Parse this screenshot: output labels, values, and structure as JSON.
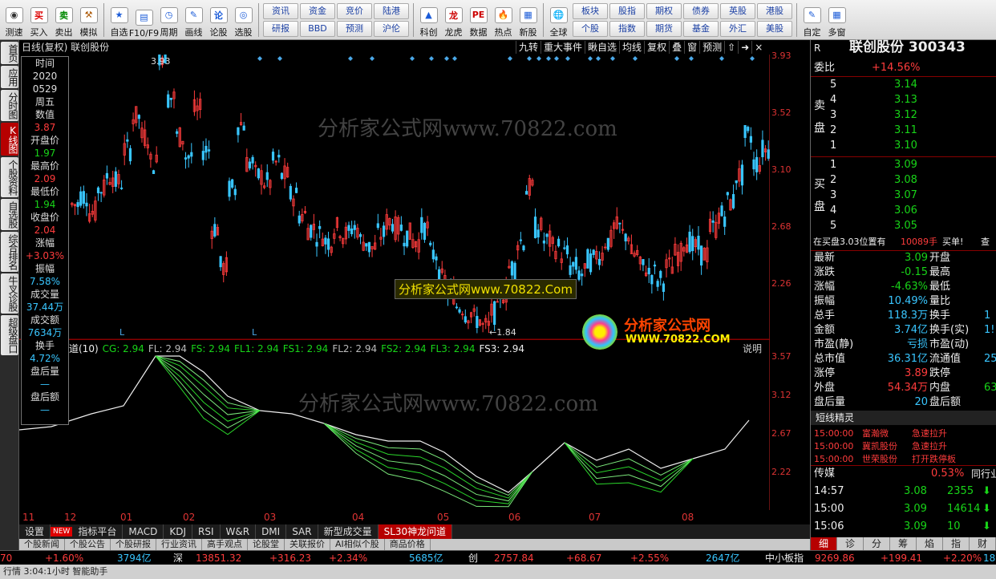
{
  "toolbar": {
    "groups1": [
      {
        "label": "测速",
        "icon": "speed-icon",
        "sym": "◉"
      },
      {
        "label": "买入",
        "icon": "buy-icon",
        "sym": "买",
        "color": "#d00"
      },
      {
        "label": "卖出",
        "icon": "sell-icon",
        "sym": "卖",
        "color": "#080"
      },
      {
        "label": "模拟",
        "icon": "hammer-icon",
        "sym": "⚒",
        "color": "#a50"
      }
    ],
    "groups2": [
      {
        "label": "自选",
        "icon": "star-icon",
        "sym": "★",
        "color": "#1a5bd8"
      },
      {
        "label": "F10/F9",
        "icon": "f10-icon",
        "sym": "▤",
        "color": "#1a5bd8"
      },
      {
        "label": "周期",
        "icon": "clock-icon",
        "sym": "◷",
        "color": "#1a5bd8"
      },
      {
        "label": "画线",
        "icon": "pencil-icon",
        "sym": "✎",
        "color": "#1a5bd8"
      },
      {
        "label": "论股",
        "icon": "discuss-icon",
        "sym": "论",
        "color": "#1a5bd8"
      },
      {
        "label": "选股",
        "icon": "select-icon",
        "sym": "◎",
        "color": "#1a5bd8"
      }
    ],
    "pairs1": [
      "资讯",
      "资金",
      "竞价",
      "陆港",
      "研报",
      "BBD",
      "预测",
      "沪伦"
    ],
    "groups3": [
      {
        "label": "科创",
        "icon": "kechuang-icon",
        "sym": "▲",
        "color": "#1a5bd8"
      },
      {
        "label": "龙虎",
        "icon": "dragon-icon",
        "sym": "龙",
        "color": "#c00"
      },
      {
        "label": "数据",
        "icon": "pe-icon",
        "sym": "PE",
        "color": "#c00"
      },
      {
        "label": "热点",
        "icon": "hot-icon",
        "sym": "🔥",
        "color": "#c00"
      },
      {
        "label": "新股",
        "icon": "ipo-icon",
        "sym": "▦",
        "color": "#1a5bd8"
      }
    ],
    "globe": {
      "label": "全球",
      "icon": "globe-icon",
      "sym": "🌐"
    },
    "pairs2": [
      "板块",
      "股指",
      "期权",
      "债券",
      "英股",
      "港股",
      "个股",
      "指数",
      "期货",
      "基金",
      "外汇",
      "美股"
    ],
    "groups4": [
      {
        "label": "自定",
        "icon": "custom-icon",
        "sym": "✎",
        "color": "#1a5bd8"
      },
      {
        "label": "多窗",
        "icon": "multiwin-icon",
        "sym": "▦",
        "color": "#1a5bd8"
      }
    ]
  },
  "leftnav": [
    "首页",
    "应用",
    "分时图",
    "K线图",
    "个股资料",
    "自选股",
    "综合排名",
    "牛叉诊股",
    "超级盘口"
  ],
  "leftnav_active": "K线图",
  "chart_header": {
    "title": "日线(复权)  联创股份",
    "tools": [
      "九转",
      "重大事件",
      "瞅自选",
      "均线",
      "复权",
      "叠",
      "窗",
      "预测",
      "⇧",
      "➜",
      "×"
    ]
  },
  "price_axis": [
    "3.93",
    "3.52",
    "3.10",
    "2.68",
    "2.26"
  ],
  "indicator_axis": [
    "3.57",
    "3.12",
    "2.67",
    "2.22"
  ],
  "x_labels": [
    "11",
    "12",
    "01",
    "02",
    "03",
    "04",
    "05",
    "06",
    "07",
    "08"
  ],
  "annotations": {
    "high": "3.93",
    "low": "1.84",
    "L1": "L",
    "L2": "L",
    "explain": "说明"
  },
  "infobox": [
    {
      "label": "时间",
      "value": "2020",
      "vcolor": "#ddd"
    },
    {
      "label": "",
      "value": "0529",
      "vcolor": "#ddd"
    },
    {
      "label": "周五",
      "value": "",
      "vcolor": "#ddd"
    },
    {
      "label": "数值",
      "value": "3.87",
      "vcolor": "#ff3c3c"
    },
    {
      "label": "开盘价",
      "value": "1.97",
      "vcolor": "#18d418"
    },
    {
      "label": "最高价",
      "value": "2.09",
      "vcolor": "#ff3c3c"
    },
    {
      "label": "最低价",
      "value": "1.94",
      "vcolor": "#18d418"
    },
    {
      "label": "收盘价",
      "value": "2.04",
      "vcolor": "#ff3c3c"
    },
    {
      "label": "涨幅",
      "value": "+3.03%",
      "vcolor": "#ff3c3c"
    },
    {
      "label": "振幅",
      "value": "7.58%",
      "vcolor": "#39c6ff"
    },
    {
      "label": "成交量",
      "value": "37.44万",
      "vcolor": "#39c6ff"
    },
    {
      "label": "成交额",
      "value": "7634万",
      "vcolor": "#39c6ff"
    },
    {
      "label": "换手",
      "value": "4.72%",
      "vcolor": "#39c6ff"
    },
    {
      "label": "盘后量",
      "value": "—",
      "vcolor": "#39c6ff"
    },
    {
      "label": "盘后额",
      "value": "—",
      "vcolor": "#39c6ff"
    }
  ],
  "indicator_legend": [
    {
      "text": "道(10)",
      "color": "#eee"
    },
    {
      "text": "CG: 2.94",
      "color": "#18d418"
    },
    {
      "text": "FL: 2.94",
      "color": "#bbb"
    },
    {
      "text": "FS: 2.94",
      "color": "#18d418"
    },
    {
      "text": "FL1: 2.94",
      "color": "#18d418"
    },
    {
      "text": "FS1: 2.94",
      "color": "#18d418"
    },
    {
      "text": "FL2: 2.94",
      "color": "#bbb"
    },
    {
      "text": "FS2: 2.94",
      "color": "#18d418"
    },
    {
      "text": "FL3: 2.94",
      "color": "#18d418"
    },
    {
      "text": "FS3: 2.94",
      "color": "#eee"
    }
  ],
  "watermarks": {
    "top": "分析家公式网www.70822.com",
    "mid": "分析家公式网www.70822.Com",
    "bottom": "分析家公式网www.70822.com",
    "logo1": "分析家公式网",
    "logo2": "WWW.70822.COM"
  },
  "bottomtabs": [
    "设置",
    "NEW",
    "指标平台",
    "MACD",
    "KDJ",
    "RSI",
    "W&R",
    "DMI",
    "SAR",
    "新型成交量",
    "SL30神龙问道"
  ],
  "bottomtabs2": [
    "个股新闻",
    "个股公告",
    "个股研报",
    "行业资讯",
    "高手观点",
    "论股堂",
    "关联报价",
    "AI相似个股",
    "商品价格"
  ],
  "statusbar": [
    {
      "t": "70",
      "c": "red"
    },
    {
      "t": "+1.60%",
      "c": "red"
    },
    {
      "t": "3794亿",
      "c": "cyan"
    },
    {
      "t": "深",
      "c": "white"
    },
    {
      "t": "13851.32",
      "c": "red"
    },
    {
      "t": "+316.23",
      "c": "red"
    },
    {
      "t": "+2.34%",
      "c": "red"
    },
    {
      "t": "5685亿",
      "c": "cyan"
    },
    {
      "t": "创",
      "c": "white"
    },
    {
      "t": "2757.84",
      "c": "red"
    },
    {
      "t": "+68.67",
      "c": "red"
    },
    {
      "t": "+2.55%",
      "c": "red"
    },
    {
      "t": "2647亿",
      "c": "cyan"
    },
    {
      "t": "中小板指",
      "c": "white"
    },
    {
      "t": "9269.86",
      "c": "red"
    },
    {
      "t": "+199.41",
      "c": "red"
    },
    {
      "t": "+2.20%",
      "c": "red"
    },
    {
      "t": "18",
      "c": "cyan"
    }
  ],
  "statusbar2": "行情  3:04:1小时  智能助手",
  "right": {
    "r_label": "R",
    "name": "联创股份 300343",
    "webi_label": "委比",
    "webi_value": "+14.56%",
    "sell_label": "卖盘",
    "sell": [
      {
        "n": "5",
        "p": "3.14"
      },
      {
        "n": "4",
        "p": "3.13"
      },
      {
        "n": "3",
        "p": "3.12"
      },
      {
        "n": "2",
        "p": "3.11"
      },
      {
        "n": "1",
        "p": "3.10"
      }
    ],
    "buy_label": "买盘",
    "buy": [
      {
        "n": "1",
        "p": "3.09"
      },
      {
        "n": "2",
        "p": "3.08"
      },
      {
        "n": "3",
        "p": "3.07"
      },
      {
        "n": "4",
        "p": "3.06"
      },
      {
        "n": "5",
        "p": "3.05"
      }
    ],
    "notice": "在买盘3.03位置有",
    "notice_vol": "10089手",
    "notice_tail": "买单!",
    "notice_end": "查",
    "stats": [
      {
        "l": "最新",
        "v": "3.09",
        "vc": "green",
        "l2": "开盘"
      },
      {
        "l": "涨跌",
        "v": "-0.15",
        "vc": "green",
        "l2": "最高"
      },
      {
        "l": "涨幅",
        "v": "-4.63%",
        "vc": "green",
        "l2": "最低"
      },
      {
        "l": "振幅",
        "v": "10.49%",
        "vc": "cyan",
        "l2": "量比"
      },
      {
        "l": "总手",
        "v": "118.3万",
        "vc": "cyan",
        "l2": "换手",
        "v2": "1",
        "v2c": "cyan"
      },
      {
        "l": "金额",
        "v": "3.74亿",
        "vc": "cyan",
        "l2": "换手(实)",
        "v2": "1!",
        "v2c": "cyan"
      },
      {
        "l": "市盈(静)",
        "v": "亏损",
        "vc": "cyan",
        "l2": "市盈(动)"
      },
      {
        "l": "总市值",
        "v": "36.31亿",
        "vc": "cyan",
        "l2": "流通值",
        "v2": "25",
        "v2c": "cyan"
      },
      {
        "l": "涨停",
        "v": "3.89",
        "vc": "red",
        "l2": "跌停"
      },
      {
        "l": "外盘",
        "v": "54.34万",
        "vc": "red",
        "l2": "内盘",
        "v2": "63",
        "v2c": "green"
      },
      {
        "l": "盘后量",
        "v": "20",
        "vc": "cyan",
        "l2": "盘后额"
      }
    ],
    "spirit_title": "短线精灵",
    "spirit": [
      {
        "t": "15:00:00",
        "s": "富瀚微",
        "e": "急速拉升"
      },
      {
        "t": "15:00:00",
        "s": "冀凯股份",
        "e": "急速拉升"
      },
      {
        "t": "15:00:00",
        "s": "世荣股份",
        "e": "打开跌停板"
      }
    ],
    "media_label": "传媒",
    "media_value": "0.53%",
    "media_tail": "同行业",
    "ticks": [
      {
        "t": "14:57",
        "p": "3.08",
        "v": "2355"
      },
      {
        "t": "15:00",
        "p": "3.09",
        "v": "14614"
      },
      {
        "t": "15:06",
        "p": "3.09",
        "v": "10"
      }
    ],
    "tabs": [
      "细",
      "诊",
      "分",
      "筹",
      "焰",
      "指",
      "财"
    ]
  },
  "colors": {
    "up": "#ff3c3c",
    "down": "#39c6ff",
    "axis": "#cc2222",
    "bg": "#000000",
    "accent": "#b60000"
  },
  "chart_data": {
    "type": "candlestick",
    "ylim": [
      1.84,
      3.93
    ],
    "x_ticks": [
      "11",
      "12",
      "01",
      "02",
      "03",
      "04",
      "05",
      "06",
      "07",
      "08"
    ],
    "close_path": [
      2.78,
      2.85,
      2.72,
      2.9,
      3.0,
      2.95,
      3.2,
      3.45,
      3.3,
      3.1,
      3.93,
      3.6,
      3.3,
      3.15,
      3.5,
      3.2,
      2.6,
      2.3,
      2.9,
      3.4,
      3.1,
      3.0,
      2.95,
      3.1,
      3.0,
      2.85,
      2.7,
      2.6,
      2.55,
      2.5,
      2.6,
      2.55,
      2.6,
      2.5,
      2.45,
      2.55,
      2.65,
      2.6,
      2.55,
      2.5,
      2.6,
      2.4,
      2.2,
      2.1,
      2.0,
      1.95,
      1.9,
      1.84,
      1.95,
      2.1,
      2.3,
      2.5,
      2.9,
      2.6,
      2.5,
      2.45,
      2.4,
      2.3,
      2.25,
      2.35,
      2.4,
      2.5,
      2.6,
      2.55,
      2.4,
      2.3,
      2.25,
      2.2,
      2.3,
      2.4,
      2.5,
      2.45,
      2.4,
      2.6,
      2.7,
      2.8,
      3.0,
      3.3,
      3.1,
      3.2
    ]
  }
}
